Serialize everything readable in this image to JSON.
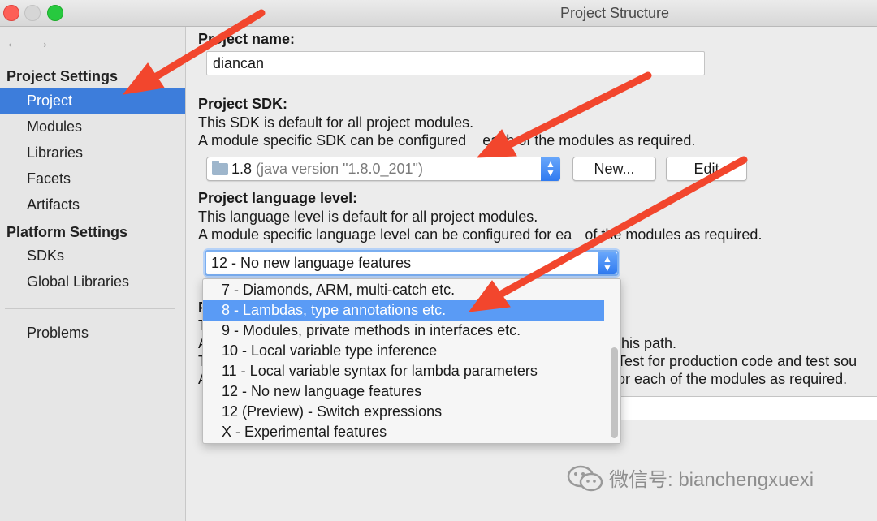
{
  "window": {
    "title": "Project Structure"
  },
  "nav": {
    "back": "←",
    "forward": "→"
  },
  "sidebar": {
    "project_settings_header": "Project Settings",
    "project_settings_items": [
      {
        "label": "Project",
        "selected": true
      },
      {
        "label": "Modules"
      },
      {
        "label": "Libraries"
      },
      {
        "label": "Facets"
      },
      {
        "label": "Artifacts"
      }
    ],
    "platform_settings_header": "Platform Settings",
    "platform_settings_items": [
      {
        "label": "SDKs"
      },
      {
        "label": "Global Libraries"
      }
    ],
    "problems": "Problems"
  },
  "project_name": {
    "label": "Project name:",
    "value": "diancan"
  },
  "project_sdk": {
    "label": "Project SDK:",
    "desc1": "This SDK is default for all project modules.",
    "desc2": "A module specific SDK can be configured",
    "desc2_tail": "each of the modules as required.",
    "sdk_version": "1.8",
    "sdk_detail": "(java version \"1.8.0_201\")",
    "new_button": "New...",
    "edit_button": "Edit"
  },
  "language_level": {
    "label": "Project language level:",
    "desc1": "This language level is default for all project modules.",
    "desc2": "A module specific language level can be configured for ea",
    "desc2_tail": "of the modules as required.",
    "selected": "12 - No new language features",
    "options": [
      "7 - Diamonds, ARM, multi-catch etc.",
      "8 - Lambdas, type annotations etc.",
      "9 - Modules, private methods in interfaces etc.",
      "10 - Local variable type inference",
      "11 - Local variable syntax for lambda parameters",
      "12 - No new language features",
      "12 (Preview) - Switch expressions",
      "X - Experimental features"
    ],
    "highlighted_index": 1
  },
  "compiler_output": {
    "partial_line1": "this path.",
    "partial_line2": "Test for production code and test sou",
    "partial_line3": "or each of the modules as required."
  },
  "watermark": {
    "text": "微信号: bianchengxuexi"
  },
  "colors": {
    "selection": "#3d7ddb",
    "highlight": "#5a9bf5",
    "annotation_arrow": "#f2462d"
  }
}
